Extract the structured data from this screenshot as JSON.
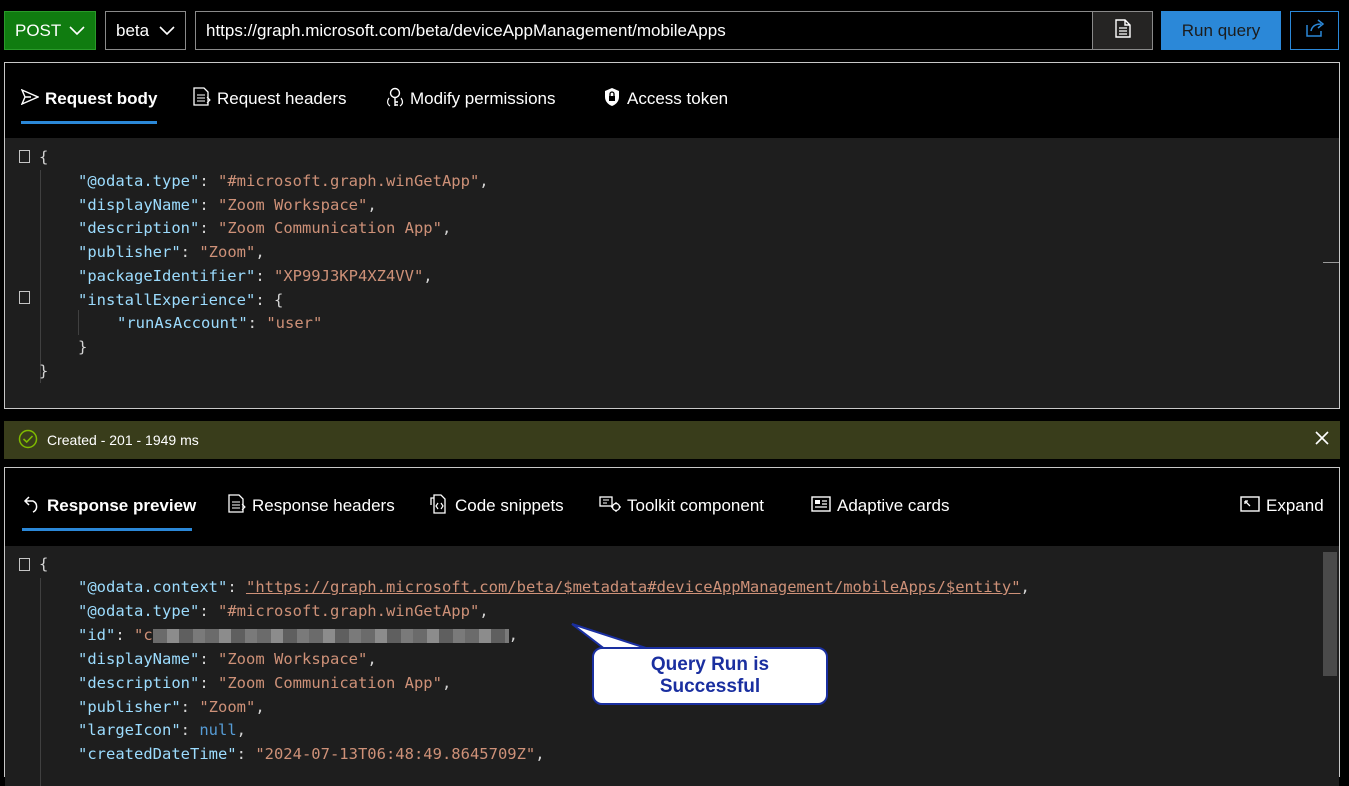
{
  "toolbar": {
    "method": "POST",
    "version": "beta",
    "url": "https://graph.microsoft.com/beta/deviceAppManagement/mobileApps",
    "run_label": "Run query"
  },
  "request_tabs": [
    "Request body",
    "Request headers",
    "Modify permissions",
    "Access token"
  ],
  "request_body": {
    "open": "{",
    "lines": [
      {
        "key": "\"@odata.type\"",
        "value": "\"#microsoft.graph.winGetApp\""
      },
      {
        "key": "\"displayName\"",
        "value": "\"Zoom Workspace\""
      },
      {
        "key": "\"description\"",
        "value": "\"Zoom Communication App\""
      },
      {
        "key": "\"publisher\"",
        "value": "\"Zoom\""
      },
      {
        "key": "\"packageIdentifier\"",
        "value": "\"XP99J3KP4XZ4VV\""
      },
      {
        "key": "\"installExperience\"",
        "value": "{"
      },
      {
        "key": "\"runAsAccount\"",
        "value": "\"user\""
      }
    ],
    "inner_close": "}",
    "close": "}"
  },
  "status": {
    "text": "Created - 201 - 1949 ms",
    "color": "#393d1b"
  },
  "response_tabs": [
    "Response preview",
    "Response headers",
    "Code snippets",
    "Toolkit component",
    "Adaptive cards"
  ],
  "expand_label": "Expand",
  "response_body": {
    "open": "{",
    "lines": [
      {
        "key": "\"@odata.context\"",
        "value": "\"https://graph.microsoft.com/beta/$metadata#deviceAppManagement/mobileApps/$entity\""
      },
      {
        "key": "\"@odata.type\"",
        "value": "\"#microsoft.graph.winGetApp\""
      },
      {
        "key": "\"id\"",
        "value": "\"c"
      },
      {
        "key": "\"displayName\"",
        "value": "\"Zoom Workspace\""
      },
      {
        "key": "\"description\"",
        "value": "\"Zoom Communication App\""
      },
      {
        "key": "\"publisher\"",
        "value": "\"Zoom\""
      },
      {
        "key": "\"largeIcon\"",
        "value": "null"
      },
      {
        "key": "\"createdDateTime\"",
        "value": "\"2024-07-13T06:48:49.8645709Z\""
      }
    ]
  },
  "callout": {
    "line1": "Query Run is",
    "line2": "Successful"
  },
  "colors": {
    "accent": "#2b88d8",
    "method_green": "#107c10",
    "json_key": "#9cdcfe",
    "json_string": "#ce9178",
    "json_null": "#569cd6"
  }
}
